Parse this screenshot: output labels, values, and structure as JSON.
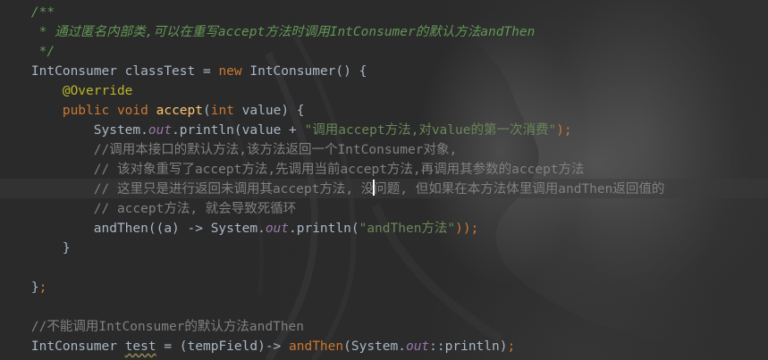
{
  "editor": {
    "name": "code-editor",
    "caret_line": 9,
    "lines": [
      [
        {
          "t": "    /**",
          "c": "doc"
        }
      ],
      [
        {
          "t": "     * 通过匿名内部类,可以在重写accept方法时调用IntConsumer的默认方法andThen",
          "c": "doc"
        }
      ],
      [
        {
          "t": "     */",
          "c": "doc"
        }
      ],
      [
        {
          "t": "    IntConsumer classTest = ",
          "c": "plain"
        },
        {
          "t": "new",
          "c": "kw"
        },
        {
          "t": " IntConsumer() {",
          "c": "plain"
        }
      ],
      [
        {
          "t": "        ",
          "c": "plain"
        },
        {
          "t": "@Override",
          "c": "ann"
        }
      ],
      [
        {
          "t": "        ",
          "c": "plain"
        },
        {
          "t": "public void ",
          "c": "kw"
        },
        {
          "t": "accept",
          "c": "fn"
        },
        {
          "t": "(",
          "c": "plain"
        },
        {
          "t": "int",
          "c": "kw"
        },
        {
          "t": " value) {",
          "c": "plain"
        }
      ],
      [
        {
          "t": "            System.",
          "c": "plain"
        },
        {
          "t": "out",
          "c": "fld"
        },
        {
          "t": ".println(value + ",
          "c": "plain"
        },
        {
          "t": "\"调用accept方法,对value的第一次消费\"",
          "c": "str"
        },
        {
          "t": ");",
          "c": "kw"
        }
      ],
      [
        {
          "t": "            //调用本接口的默认方法,该方法返回一个IntConsumer对象,",
          "c": "cmt"
        }
      ],
      [
        {
          "t": "            // 该对象重写了accept方法,先调用当前accept方法,再调用其参数的accept方法",
          "c": "cmt"
        }
      ],
      [
        {
          "t": "            // 这里只是进行返回未调用其accept方法, 没",
          "c": "cmt"
        },
        {
          "t": "",
          "c": "caret"
        },
        {
          "t": "问题, 但如果在本方法体里调用andThen返回值的",
          "c": "cmt"
        }
      ],
      [
        {
          "t": "            // accept方法, 就会导致死循环",
          "c": "cmt"
        }
      ],
      [
        {
          "t": "            andThen((a) -> System.",
          "c": "plain"
        },
        {
          "t": "out",
          "c": "fld"
        },
        {
          "t": ".println(",
          "c": "plain"
        },
        {
          "t": "\"andThen方法\"",
          "c": "str"
        },
        {
          "t": "));",
          "c": "kw"
        }
      ],
      [
        {
          "t": "        }",
          "c": "plain"
        }
      ],
      [
        {
          "t": "",
          "c": "plain"
        }
      ],
      [
        {
          "t": "    }",
          "c": "plain"
        },
        {
          "t": ";",
          "c": "kw"
        }
      ],
      [
        {
          "t": "",
          "c": "plain"
        }
      ],
      [
        {
          "t": "    //不能调用IntConsumer的默认方法andThen",
          "c": "cmt"
        }
      ],
      [
        {
          "t": "    IntConsumer ",
          "c": "plain"
        },
        {
          "t": "test",
          "c": "plain warn"
        },
        {
          "t": " = (tempField)-> ",
          "c": "plain"
        },
        {
          "t": "andThen",
          "c": "mref"
        },
        {
          "t": "(System.",
          "c": "plain"
        },
        {
          "t": "out",
          "c": "fld"
        },
        {
          "t": "::println)",
          "c": "plain"
        },
        {
          "t": ";",
          "c": "kw"
        }
      ]
    ]
  },
  "colors": {
    "background": "#2b2b2b",
    "default_text": "#a9b7c6",
    "keyword": "#cc7832",
    "line_comment": "#808080",
    "doc_comment": "#629755",
    "string": "#6a8759",
    "annotation": "#bbb529",
    "method_declaration": "#ffc66d",
    "static_field": "#9876aa"
  },
  "background_image": "grayscale-portrait-wallpaper"
}
